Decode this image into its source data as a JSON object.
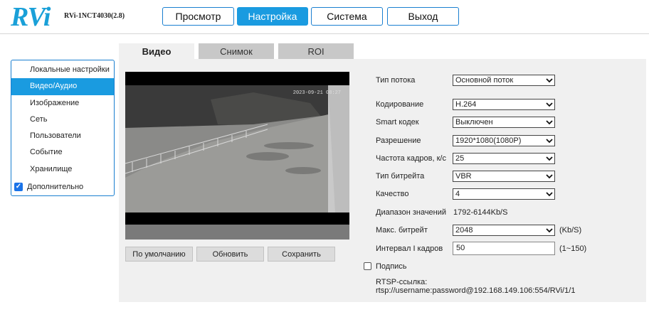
{
  "header": {
    "logo": "RVi",
    "model": "RVi-1NCT4030(2.8)",
    "nav": [
      "Просмотр",
      "Настройка",
      "Система",
      "Выход"
    ],
    "active_nav": "Настройка"
  },
  "sidebar": {
    "items": [
      {
        "label": "Локальные настройки",
        "active": false
      },
      {
        "label": "Видео/Аудио",
        "active": true
      },
      {
        "label": "Изображение",
        "active": false
      },
      {
        "label": "Сеть",
        "active": false
      },
      {
        "label": "Пользователи",
        "active": false
      },
      {
        "label": "Событие",
        "active": false
      },
      {
        "label": "Хранилище",
        "active": false
      }
    ],
    "advanced_label": "Дополнительно",
    "advanced_checked": true
  },
  "tabs": [
    "Видео",
    "Снимок",
    "ROI"
  ],
  "video": {
    "osd": "2023-09-21 08:27"
  },
  "buttons": {
    "default": "По умолчанию",
    "refresh": "Обновить",
    "save": "Сохранить"
  },
  "form": {
    "stream_type": {
      "label": "Тип потока",
      "value": "Основной поток"
    },
    "encoding": {
      "label": "Кодирование",
      "value": "H.264"
    },
    "smart_codec": {
      "label": "Smart кодек",
      "value": "Выключен"
    },
    "resolution": {
      "label": "Разрешение",
      "value": "1920*1080(1080P)"
    },
    "framerate": {
      "label": "Частота кадров, к/с",
      "value": "25"
    },
    "bitrate_type": {
      "label": "Тип битрейта",
      "value": "VBR"
    },
    "quality": {
      "label": "Качество",
      "value": "4"
    },
    "range": {
      "label": "Диапазон значений",
      "value": "1792-6144Kb/S"
    },
    "max_bitrate": {
      "label": "Макс. битрейт",
      "value": "2048",
      "unit": "(Kb/S)"
    },
    "i_interval": {
      "label": "Интервал I кадров",
      "value": "50",
      "unit": "(1~150)"
    },
    "caption": {
      "label": "Подпись",
      "checked": false
    },
    "rtsp": {
      "label": "RTSP-ссылка:",
      "value": "rtsp://username:password@192.168.149.106:554/RVi/1/1"
    }
  },
  "colors": {
    "accent": "#1a9be0",
    "logo": "#1aa0d8",
    "panel": "#f0f0f0"
  }
}
